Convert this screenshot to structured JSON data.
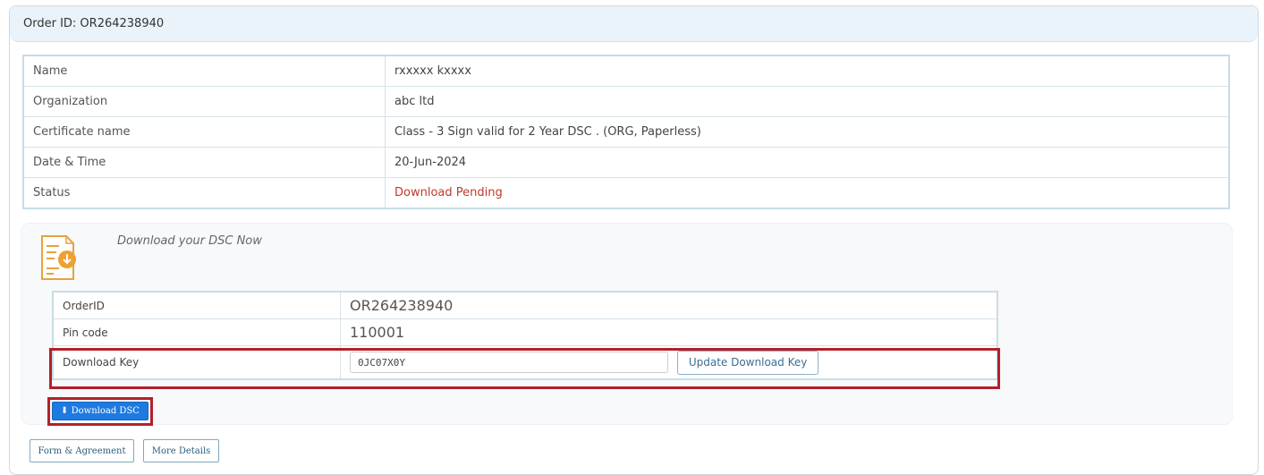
{
  "order": {
    "header": "Order ID: OR264238940"
  },
  "details": [
    {
      "label": "Name",
      "value": "rxxxxx kxxxx"
    },
    {
      "label": "Organization",
      "value": "abc ltd"
    },
    {
      "label": "Certificate name",
      "value": "Class - 3 Sign valid for 2 Year DSC . (ORG, Paperless)"
    },
    {
      "label": "Date & Time",
      "value": "20-Jun-2024"
    },
    {
      "label": "Status",
      "value": "Download Pending"
    }
  ],
  "download": {
    "heading": "Download your DSC Now",
    "order_id_label": "OrderID",
    "order_id_value": "OR264238940",
    "pin_label": "Pin code",
    "pin_value": "110001",
    "key_label": "Download Key",
    "key_value": "0JC07X0Y",
    "update_button": "Update Download Key",
    "download_button": "Download DSC"
  },
  "footer": {
    "form_button": "Form & Agreement",
    "more_button": "More Details"
  },
  "icons": {
    "document": "document-download-icon",
    "download": "download-arrow-icon"
  },
  "colors": {
    "status_pending": "#c0392b",
    "primary_button": "#1e7ae0",
    "highlight": "#b3202a",
    "header_bg": "#eaf3f9"
  }
}
